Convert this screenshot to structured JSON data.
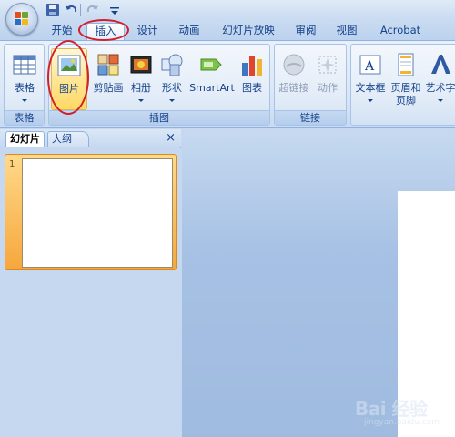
{
  "quick_access": {
    "icons": [
      "save-icon",
      "undo-icon",
      "redo-icon",
      "customize-icon"
    ]
  },
  "tabs": [
    {
      "label": "开始"
    },
    {
      "label": "插入",
      "active": true
    },
    {
      "label": "设计"
    },
    {
      "label": "动画"
    },
    {
      "label": "幻灯片放映"
    },
    {
      "label": "审阅"
    },
    {
      "label": "视图"
    },
    {
      "label": "Acrobat"
    }
  ],
  "ribbon": {
    "groups": {
      "tables": {
        "label": "表格",
        "buttons": [
          {
            "label": "表格"
          }
        ]
      },
      "illustrations": {
        "label": "插图",
        "buttons": [
          {
            "label": "图片"
          },
          {
            "label": "剪贴画"
          },
          {
            "label": "相册"
          },
          {
            "label": "形状"
          },
          {
            "label": "SmartArt"
          },
          {
            "label": "图表"
          }
        ]
      },
      "links": {
        "label": "链接",
        "buttons": [
          {
            "label": "超链接"
          },
          {
            "label": "动作"
          }
        ]
      },
      "text": {
        "label": "",
        "buttons": [
          {
            "label": "文本框"
          },
          {
            "label": "页眉和",
            "label2": "页脚"
          },
          {
            "label": "艺术字"
          }
        ]
      }
    }
  },
  "pane": {
    "tabs": [
      {
        "label": "幻灯片"
      },
      {
        "label": "大纲"
      }
    ],
    "close": "×",
    "slide_number": "1"
  },
  "watermark": {
    "text": "Bai 经验",
    "url": "jingyan.baidu.com"
  },
  "colors": {
    "accent": "#15428b",
    "highlight": "#d21f2c",
    "selection": "#f6a73d"
  }
}
